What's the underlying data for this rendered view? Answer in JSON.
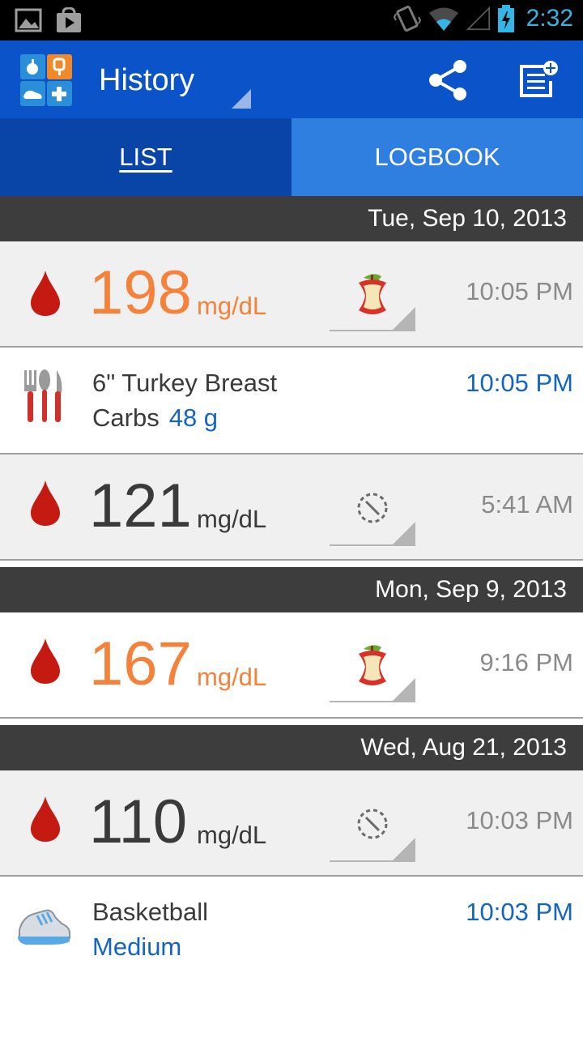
{
  "status_bar": {
    "time": "2:32",
    "icons": [
      "gallery-icon",
      "play-store-icon",
      "vibrate-icon",
      "wifi-icon",
      "signal-icon",
      "battery-charging-icon"
    ]
  },
  "action_bar": {
    "title": "History",
    "icons": [
      "app-logo-icon",
      "share-icon",
      "add-note-icon"
    ]
  },
  "tabs": [
    {
      "label": "LIST",
      "selected": true
    },
    {
      "label": "LOGBOOK",
      "selected": false
    }
  ],
  "dates": {
    "d1": "Tue, Sep 10, 2013",
    "d2": "Mon, Sep 9, 2013",
    "d3": "Wed, Aug 21, 2013"
  },
  "entries": {
    "e1": {
      "value": "198",
      "unit": "mg/dL",
      "time": "10:05 PM",
      "meal_icon": "apple-core-icon",
      "level_color": "#f5823a"
    },
    "e2": {
      "food": "6\" Turkey Breast",
      "carbs_label": "Carbs",
      "carbs_value": "48 g",
      "time": "10:05 PM",
      "icon": "fork-spoon-knife-icon"
    },
    "e3": {
      "value": "121",
      "unit": "mg/dL",
      "time": "5:41 AM",
      "meal_icon": "no-tag-icon"
    },
    "e4": {
      "value": "167",
      "unit": "mg/dL",
      "time": "9:16 PM",
      "meal_icon": "apple-core-icon",
      "level_color": "#f5823a"
    },
    "e5": {
      "value": "110",
      "unit": "mg/dL",
      "time": "10:03 PM",
      "meal_icon": "no-tag-icon"
    },
    "e6": {
      "activity": "Basketball",
      "intensity": "Medium",
      "time": "10:03 PM",
      "icon": "sneaker-icon"
    }
  },
  "colors": {
    "action_bar": "#0a53c8",
    "tab_selected": "#0845a6",
    "tab_unselected": "#2f7fe0",
    "high_value": "#f5823a",
    "link_blue": "#1565c0",
    "date_header": "#3d3d3d"
  }
}
